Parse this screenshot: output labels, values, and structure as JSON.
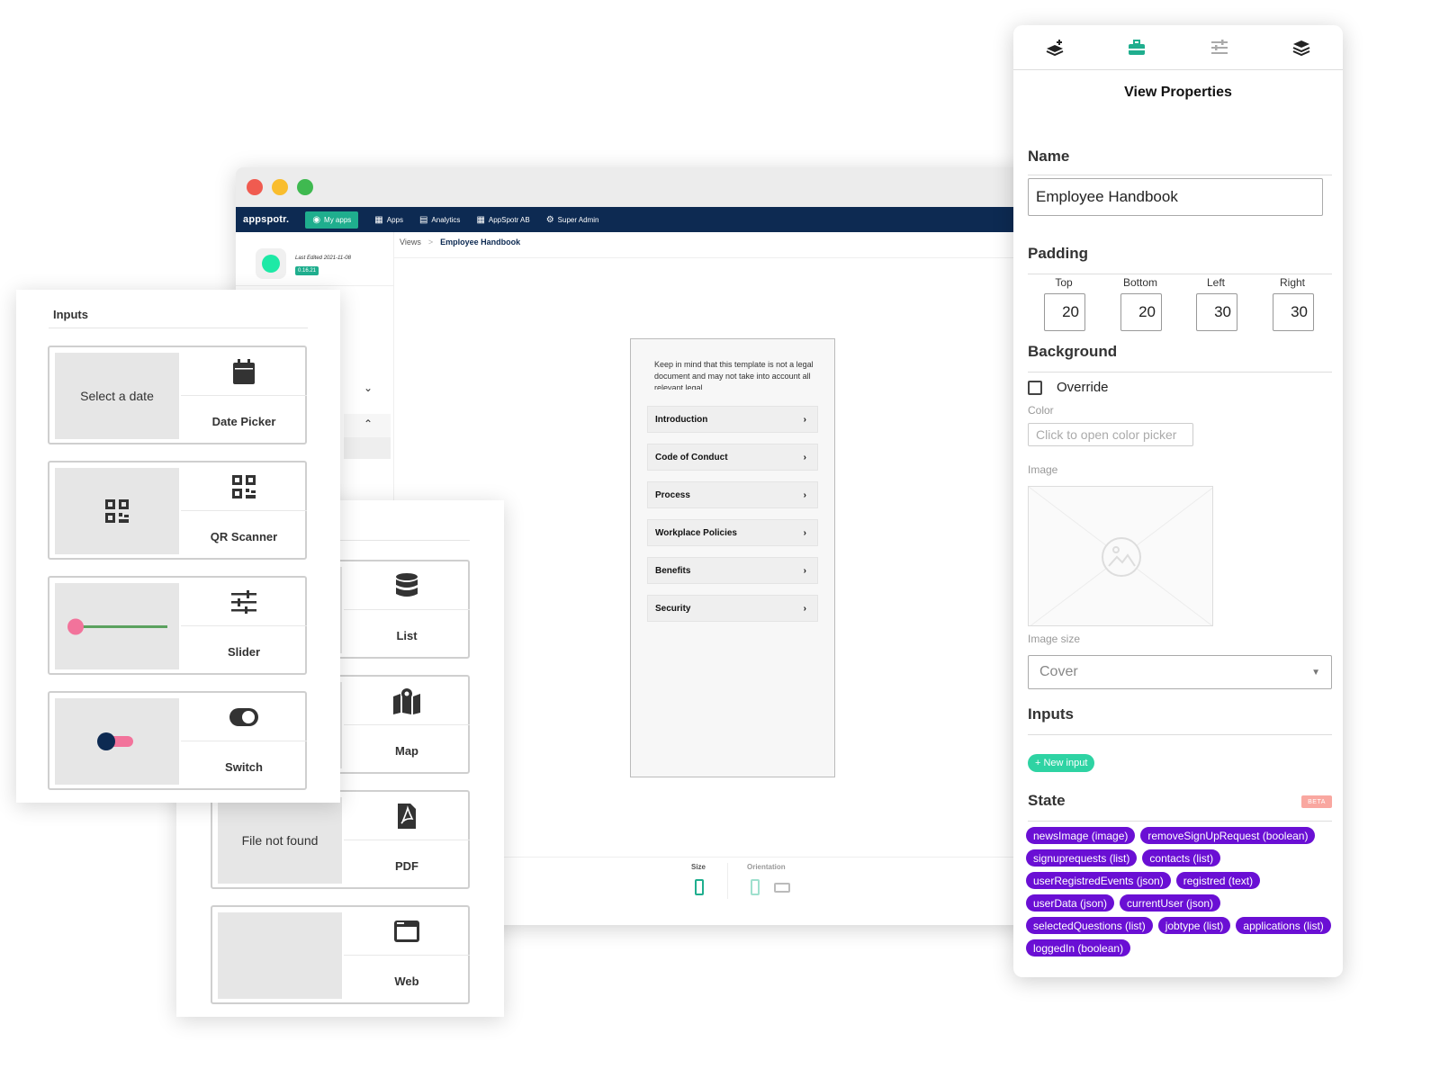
{
  "browser": {
    "nav": {
      "brand": "appspotr.",
      "items": [
        "My apps",
        "Apps",
        "Analytics",
        "AppSpotr AB",
        "Super Admin"
      ]
    },
    "sidebar": {
      "last_edited": "Last Edited 2021-11-08",
      "version": "0.16.21"
    },
    "breadcrumb": {
      "root": "Views",
      "sep": ">",
      "current": "Employee Handbook"
    },
    "phone": {
      "intro_text": "Keep in mind that this template is not a legal document and may not take into account all relevant legal",
      "items": [
        "Introduction",
        "Code of Conduct",
        "Process",
        "Workplace Policies",
        "Benefits",
        "Security"
      ]
    },
    "bottom": {
      "size_label": "Size",
      "orientation_label": "Orientation"
    }
  },
  "inputs_panel": {
    "title": "Inputs",
    "cards": [
      {
        "preview": "Select a date",
        "label": "Date Picker",
        "icon": "calendar-icon"
      },
      {
        "preview": "",
        "label": "QR Scanner",
        "icon": "qr-code-icon"
      },
      {
        "preview": "",
        "label": "Slider",
        "icon": "sliders-icon"
      },
      {
        "preview": "",
        "label": "Switch",
        "icon": "toggle-icon"
      }
    ]
  },
  "components_panel": {
    "cards": [
      {
        "preview": "",
        "label": "List",
        "icon": "database-icon"
      },
      {
        "preview": "",
        "label": "Map",
        "icon": "map-pin-icon"
      },
      {
        "preview": "File not found",
        "label": "PDF",
        "icon": "pdf-icon"
      },
      {
        "preview": "",
        "label": "Web",
        "icon": "browser-window-icon"
      }
    ]
  },
  "props": {
    "title": "View Properties",
    "name_label": "Name",
    "name_value": "Employee Handbook",
    "padding_label": "Padding",
    "padding": [
      {
        "label": "Top",
        "value": "20"
      },
      {
        "label": "Bottom",
        "value": "20"
      },
      {
        "label": "Left",
        "value": "30"
      },
      {
        "label": "Right",
        "value": "30"
      }
    ],
    "background_label": "Background",
    "override_label": "Override",
    "color_label": "Color",
    "color_placeholder": "Click to open color picker",
    "image_label": "Image",
    "image_size_label": "Image size",
    "image_size_value": "Cover",
    "inputs_label": "Inputs",
    "new_input": "+ New input",
    "state_label": "State",
    "beta": "BETA",
    "state_chips": [
      "newsImage (image)",
      "removeSignUpRequest (boolean)",
      "signuprequests (list)",
      "contacts (list)",
      "userRegistredEvents (json)",
      "registred (text)",
      "userData (json)",
      "currentUser (json)",
      "selectedQuestions (list)",
      "jobtype (list)",
      "applications (list)",
      "loggedIn (boolean)"
    ]
  },
  "colors": {
    "navy": "#0d2a52",
    "accent_green": "#1fae8e",
    "chip_purple": "#6a0fd4",
    "slider_pink": "#f2739b",
    "switch_pink": "#f2739b"
  }
}
